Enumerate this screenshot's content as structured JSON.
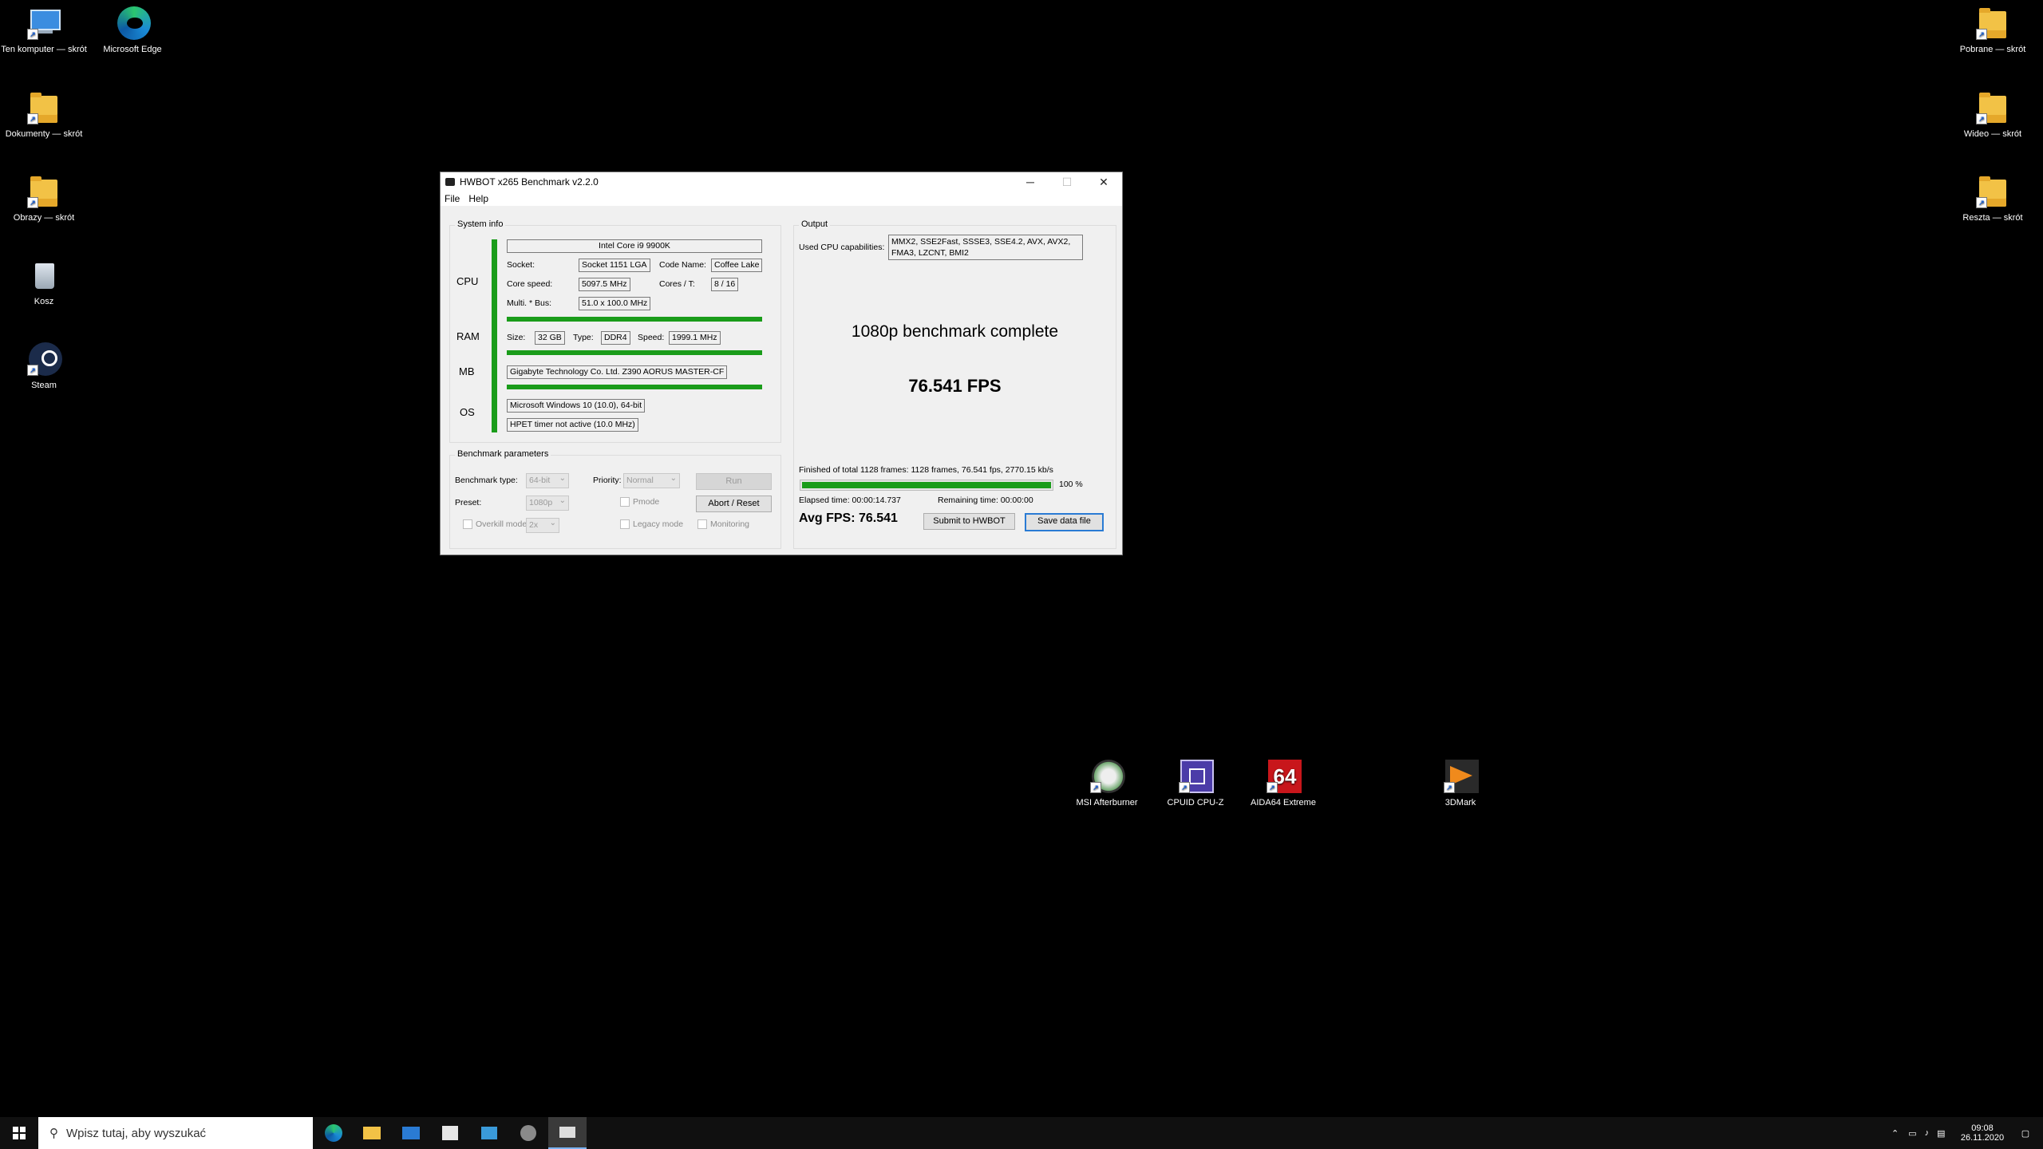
{
  "desktop_icons": [
    {
      "label": "Ten komputer — skrót",
      "icon": "computer-icon"
    },
    {
      "label": "Microsoft Edge",
      "icon": "edge-icon"
    },
    {
      "label": "Dokumenty — skrót",
      "icon": "folder-icon"
    },
    {
      "label": "Obrazy — skrót",
      "icon": "folder-icon"
    },
    {
      "label": "Kosz",
      "icon": "recycle-bin-icon"
    },
    {
      "label": "Steam",
      "icon": "steam-icon"
    },
    {
      "label": "Pobrane — skrót",
      "icon": "folder-icon"
    },
    {
      "label": "Wideo — skrót",
      "icon": "folder-icon"
    },
    {
      "label": "Reszta — skrót",
      "icon": "folder-icon"
    },
    {
      "label": "MSI Afterburner",
      "icon": "msi-afterburner-icon"
    },
    {
      "label": "CPUID CPU-Z",
      "icon": "cpuz-icon"
    },
    {
      "label": "AIDA64 Extreme",
      "icon": "aida64-icon"
    },
    {
      "label": "3DMark",
      "icon": "3dmark-icon"
    }
  ],
  "window": {
    "title": "HWBOT x265 Benchmark v2.2.0",
    "menu": [
      "File",
      "Help"
    ],
    "controls": {
      "minimize": "─",
      "maximize": "☐",
      "close": "✕"
    }
  },
  "system_info": {
    "group_label": "System info",
    "cpu_label": "CPU",
    "ram_label": "RAM",
    "mb_label": "MB",
    "os_label": "OS",
    "cpu_name": "Intel Core i9 9900K",
    "socket_label": "Socket:",
    "socket": "Socket 1151 LGA",
    "codename_label": "Code Name:",
    "codename": "Coffee Lake",
    "core_speed_label": "Core speed:",
    "core_speed": "5097.5 MHz",
    "cores_label": "Cores / T:",
    "cores": "8 / 16",
    "multi_label": "Multi. * Bus:",
    "multi": "51.0 x 100.0 MHz",
    "size_label": "Size:",
    "ram_size": "32 GB",
    "type_label": "Type:",
    "ram_type": "DDR4",
    "speed_label": "Speed:",
    "ram_speed": "1999.1 MHz",
    "motherboard": "Gigabyte Technology Co. Ltd. Z390 AORUS MASTER-CF",
    "os": "Microsoft Windows 10 (10.0), 64-bit",
    "hpet": "HPET timer not active (10.0 MHz)",
    "accent": "#1a9c1a"
  },
  "benchmark_params": {
    "group_label": "Benchmark parameters",
    "type_label": "Benchmark type:",
    "type_value": "64-bit",
    "priority_label": "Priority:",
    "priority_value": "Normal",
    "run_label": "Run",
    "preset_label": "Preset:",
    "preset_value": "1080p",
    "pmode_label": "Pmode",
    "abort_label": "Abort / Reset",
    "overkill_label": "Overkill mode",
    "overkill_value": "2x",
    "legacy_label": "Legacy mode",
    "monitoring_label": "Monitoring"
  },
  "output": {
    "group_label": "Output",
    "cpu_caps_label": "Used CPU capabilities:",
    "cpu_caps_line1": "MMX2, SSE2Fast, SSSE3, SSE4.2, AVX, AVX2,",
    "cpu_caps_line2": "FMA3, LZCNT, BMI2",
    "headline": "1080p benchmark complete",
    "fps": "76.541 FPS",
    "finished": "Finished of total 1128 frames: 1128 frames, 76.541 fps,  2770.15 kb/s",
    "progress_fraction": 1.0,
    "progress_text": "100 %",
    "elapsed": "Elapsed time: 00:00:14.737",
    "remaining": "Remaining time: 00:00:00",
    "avg_fps": "Avg FPS: 76.541",
    "submit_label": "Submit to HWBOT",
    "save_label": "Save data file"
  },
  "taskbar": {
    "search_placeholder": "Wpisz tutaj, aby wyszukać",
    "pinned": [
      "edge-icon",
      "file-explorer-icon",
      "mail-icon",
      "store-icon",
      "cpuz-taskbar-icon",
      "steam-taskbar-icon",
      "hwbot-taskbar-icon"
    ],
    "time": "09:08",
    "date": "26.11.2020"
  }
}
